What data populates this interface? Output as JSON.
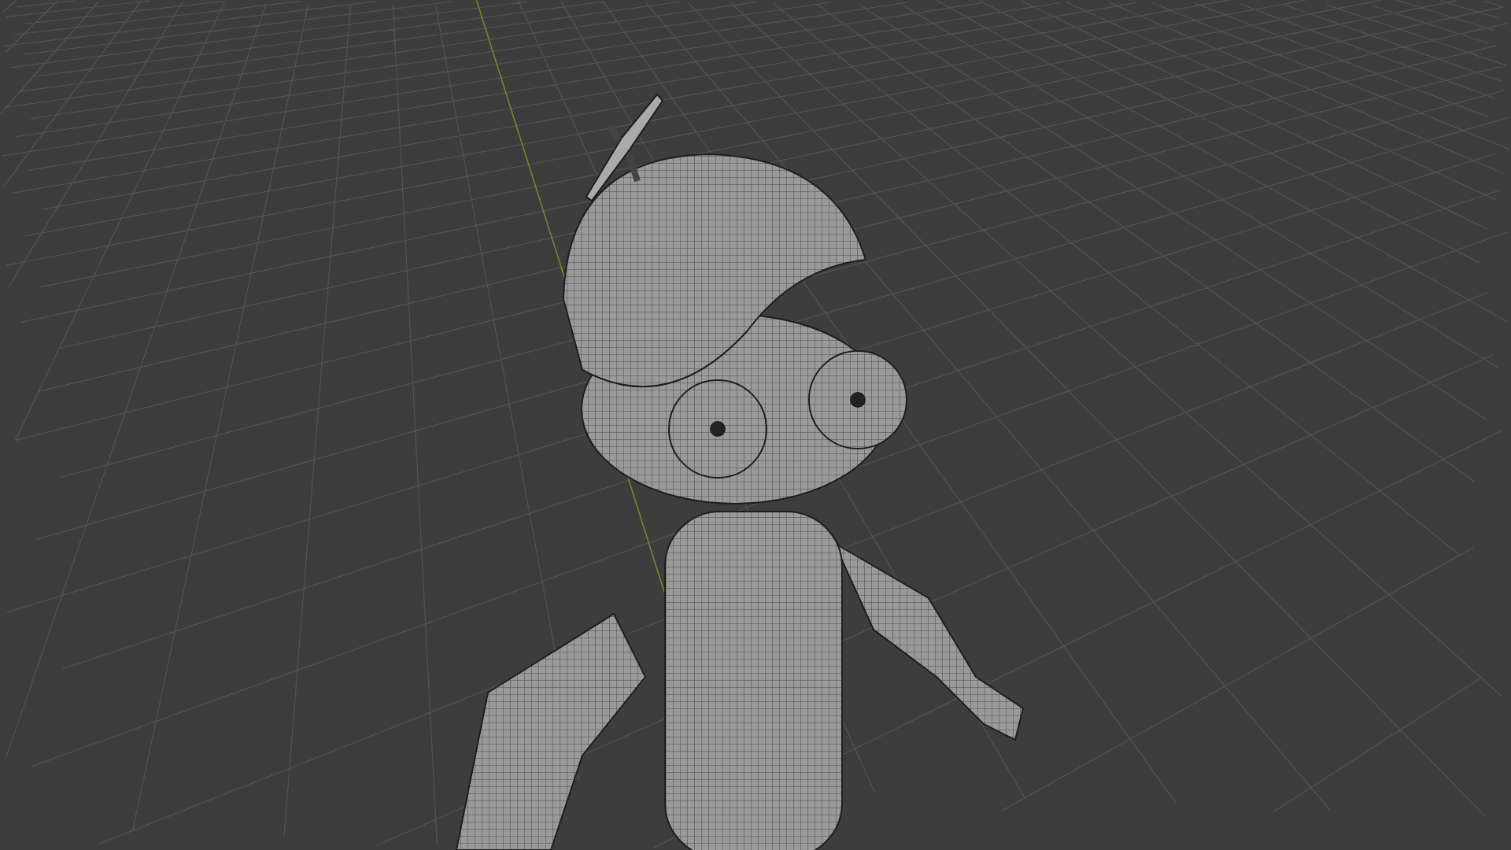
{
  "viewport": {
    "show_floor_grid": true,
    "show_axes": true
  }
}
